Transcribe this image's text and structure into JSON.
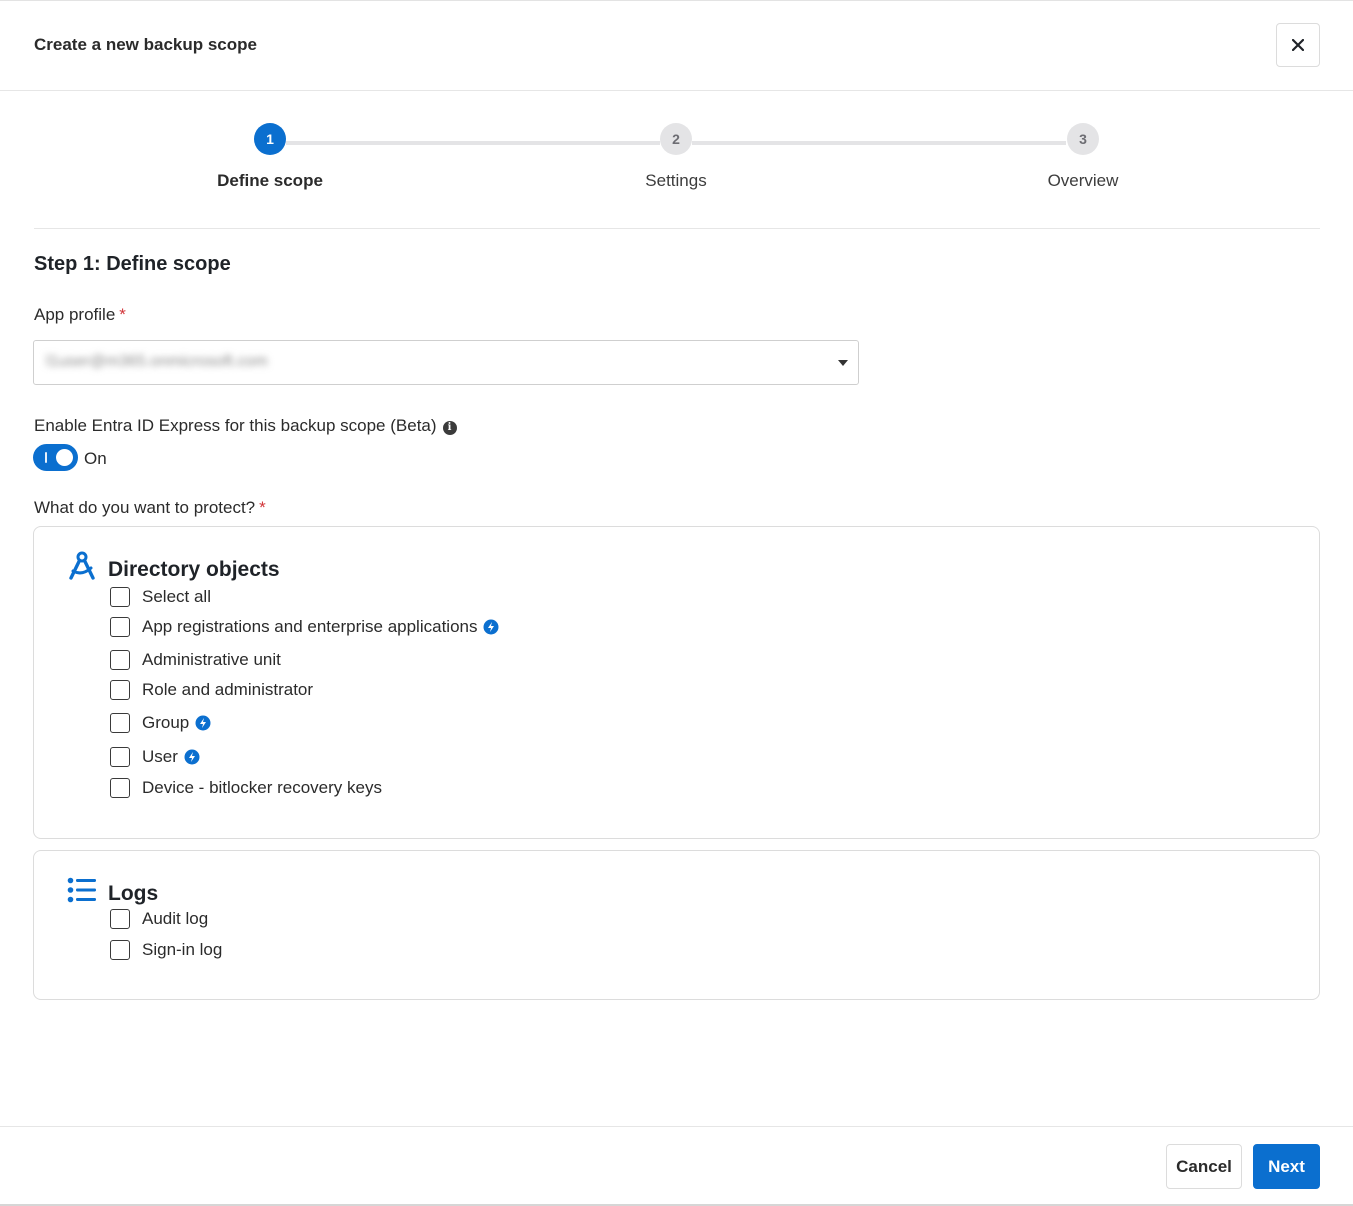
{
  "dialog": {
    "title": "Create a new backup scope",
    "close_icon": "close-icon"
  },
  "stepper": {
    "steps": [
      {
        "number": "1",
        "label": "Define scope",
        "state": "active"
      },
      {
        "number": "2",
        "label": "Settings",
        "state": "inactive"
      },
      {
        "number": "3",
        "label": "Overview",
        "state": "inactive"
      }
    ]
  },
  "form": {
    "section_title": "Step 1: Define scope",
    "app_profile": {
      "label": "App profile",
      "required_mark": "*",
      "value": "l1user@m365.onmicrosoft.com"
    },
    "express": {
      "label": "Enable Entra ID Express for this backup scope (Beta)",
      "info_icon": "info-icon",
      "toggle_state": "On",
      "enabled": true
    },
    "protect": {
      "label": "What do you want to protect?",
      "required_mark": "*"
    }
  },
  "directory_objects": {
    "title": "Directory objects",
    "icon": "compass-drafting-icon",
    "items": [
      {
        "label": "Select all",
        "checked": false,
        "express": false
      },
      {
        "label": "App registrations and enterprise applications",
        "checked": false,
        "express": true
      },
      {
        "label": "Administrative unit",
        "checked": false,
        "express": false
      },
      {
        "label": "Role and administrator",
        "checked": false,
        "express": false
      },
      {
        "label": "Group",
        "checked": false,
        "express": true
      },
      {
        "label": "User",
        "checked": false,
        "express": true
      },
      {
        "label": "Device - bitlocker recovery keys",
        "checked": false,
        "express": false
      }
    ]
  },
  "logs": {
    "title": "Logs",
    "icon": "list-icon",
    "items": [
      {
        "label": "Audit log",
        "checked": false
      },
      {
        "label": "Sign-in log",
        "checked": false
      }
    ]
  },
  "footer": {
    "cancel_label": "Cancel",
    "next_label": "Next"
  },
  "colors": {
    "accent": "#0b6fcf",
    "required": "#d13438",
    "border": "#dcdcdc"
  }
}
